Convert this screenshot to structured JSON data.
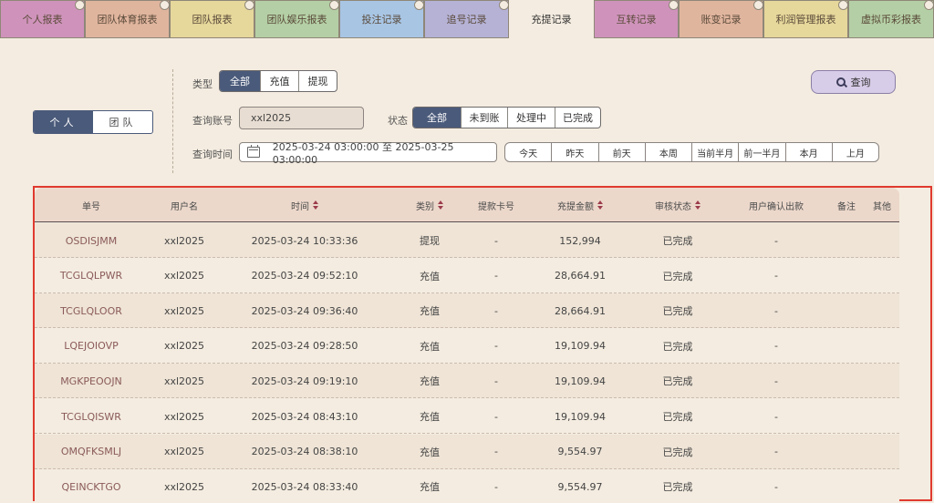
{
  "tabs": [
    {
      "label": "个人报表",
      "color": "#cf93bb"
    },
    {
      "label": "团队体育报表",
      "color": "#e0b59e"
    },
    {
      "label": "团队报表",
      "color": "#e6d79b"
    },
    {
      "label": "团队娱乐报表",
      "color": "#b4cfa5"
    },
    {
      "label": "投注记录",
      "color": "#a8c5e4"
    },
    {
      "label": "追号记录",
      "color": "#b5b2d6"
    },
    {
      "label": "充提记录",
      "color": "#f4ece0"
    },
    {
      "label": "互转记录",
      "color": "#cf93bb"
    },
    {
      "label": "账变记录",
      "color": "#e0b59e"
    },
    {
      "label": "利润管理报表",
      "color": "#e6d79b"
    },
    {
      "label": "虚拟币彩报表",
      "color": "#b4cfa5"
    }
  ],
  "scope": {
    "personal": "个人",
    "team": "团队"
  },
  "filters": {
    "type_label": "类型",
    "type_options": [
      "全部",
      "充值",
      "提现"
    ],
    "account_label": "查询账号",
    "account_value": "xxl2025",
    "status_label": "状态",
    "status_options": [
      "全部",
      "未到账",
      "处理中",
      "已完成"
    ],
    "time_label": "查询时间",
    "time_range": "2025-03-24 03:00:00 至 2025-03-25 03:00:00",
    "quick_ranges": [
      "今天",
      "昨天",
      "前天",
      "本周",
      "当前半月",
      "前一半月",
      "本月",
      "上月"
    ],
    "query_label": "查询"
  },
  "table": {
    "headers": [
      "单号",
      "用户名",
      "时间",
      "类别",
      "提款卡号",
      "充提金额",
      "审核状态",
      "用户确认出款",
      "备注",
      "其他"
    ],
    "rows": [
      [
        "OSDISJMM",
        "xxl2025",
        "2025-03-24 10:33:36",
        "提现",
        "-",
        "152,994",
        "已完成",
        "-"
      ],
      [
        "TCGLQLPWR",
        "xxl2025",
        "2025-03-24 09:52:10",
        "充值",
        "-",
        "28,664.91",
        "已完成",
        "-"
      ],
      [
        "TCGLQLOOR",
        "xxl2025",
        "2025-03-24 09:36:40",
        "充值",
        "-",
        "28,664.91",
        "已完成",
        "-"
      ],
      [
        "LQEJOIOVP",
        "xxl2025",
        "2025-03-24 09:28:50",
        "充值",
        "-",
        "19,109.94",
        "已完成",
        "-"
      ],
      [
        "MGKPEOOJN",
        "xxl2025",
        "2025-03-24 09:19:10",
        "充值",
        "-",
        "19,109.94",
        "已完成",
        "-"
      ],
      [
        "TCGLQISWR",
        "xxl2025",
        "2025-03-24 08:43:10",
        "充值",
        "-",
        "19,109.94",
        "已完成",
        "-"
      ],
      [
        "OMQFKSMLJ",
        "xxl2025",
        "2025-03-24 08:38:10",
        "充值",
        "-",
        "9,554.97",
        "已完成",
        "-"
      ],
      [
        "QEINCKTGO",
        "xxl2025",
        "2025-03-24 08:33:40",
        "充值",
        "-",
        "9,554.97",
        "已完成",
        "-"
      ]
    ]
  }
}
